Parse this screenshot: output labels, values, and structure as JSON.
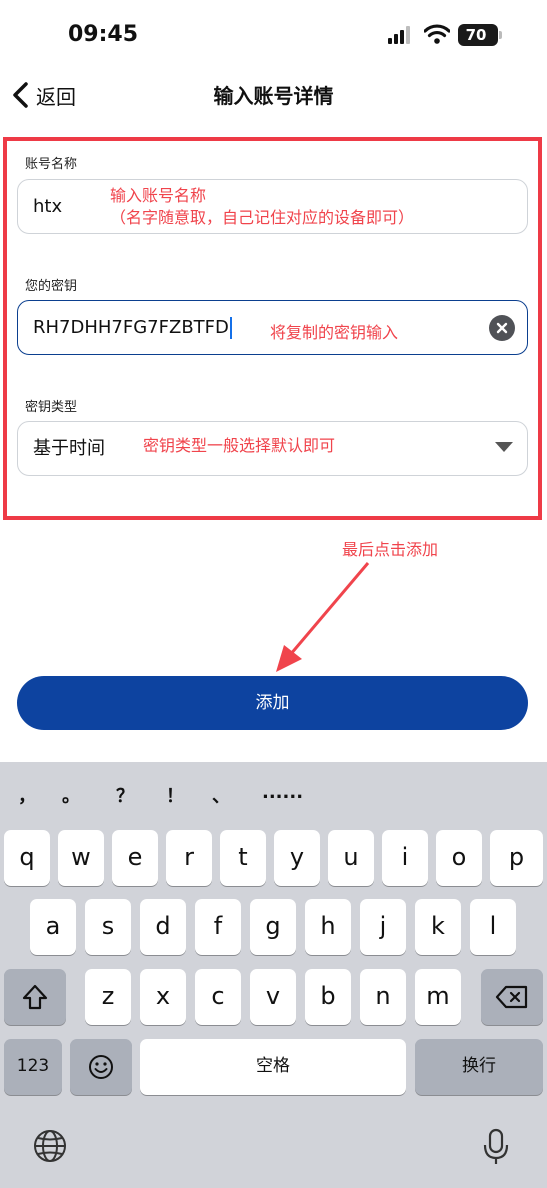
{
  "status_bar": {
    "time": "09:45",
    "battery": "70"
  },
  "nav": {
    "back_label": "返回",
    "title": "输入账号详情"
  },
  "form": {
    "account_name": {
      "label": "账号名称",
      "value": "htx",
      "annotation_line1": "输入账号名称",
      "annotation_line2": "（名字随意取，自己记住对应的设备即可）"
    },
    "secret_key": {
      "label": "您的密钥",
      "value": "RH7DHH7FG7FZBTFD",
      "annotation": "将复制的密钥输入"
    },
    "key_type": {
      "label": "密钥类型",
      "value": "基于时间",
      "annotation": "密钥类型一般选择默认即可"
    }
  },
  "arrow_annotation": "最后点击添加",
  "submit_label": "添加",
  "keyboard": {
    "candidates": [
      "，",
      "。",
      "？",
      "！",
      "、",
      "......"
    ],
    "row1": [
      "q",
      "w",
      "e",
      "r",
      "t",
      "y",
      "u",
      "i",
      "o",
      "p"
    ],
    "row2": [
      "a",
      "s",
      "d",
      "f",
      "g",
      "h",
      "j",
      "k",
      "l"
    ],
    "row3": [
      "z",
      "x",
      "c",
      "v",
      "b",
      "n",
      "m"
    ],
    "numbers_label": "123",
    "space_label": "空格",
    "return_label": "换行"
  },
  "colors": {
    "accent": "#0d43a0",
    "annotation": "#f0444c"
  }
}
